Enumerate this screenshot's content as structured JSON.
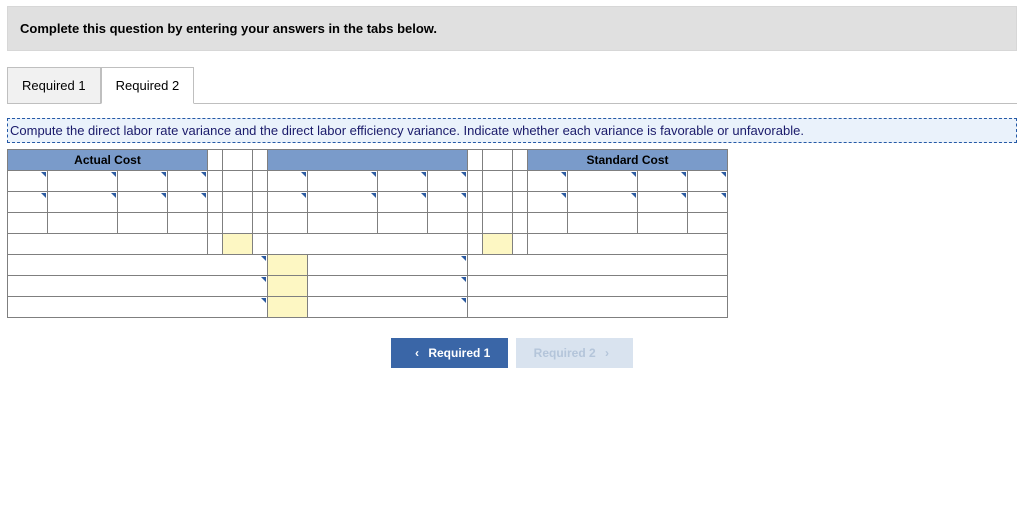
{
  "instruction": "Complete this question by entering your answers in the tabs below.",
  "tabs": {
    "t1": "Required 1",
    "t2": "Required 2"
  },
  "sub_instruction": "Compute the direct labor rate variance and the direct labor efficiency variance. Indicate whether each variance is favorable or unfavorable.",
  "headers": {
    "actual": "Actual Cost",
    "standard": "Standard Cost"
  },
  "nav": {
    "prev": "Required 1",
    "next": "Required 2"
  }
}
